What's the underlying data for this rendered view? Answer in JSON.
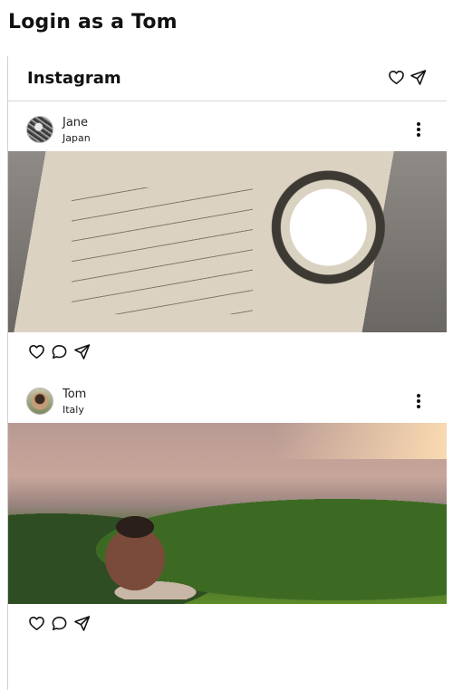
{
  "page": {
    "title": "Login as a Tom"
  },
  "app": {
    "brand": "Instagram",
    "header_icons": [
      "heart-icon",
      "send-icon"
    ]
  },
  "posts": [
    {
      "user": "Jane",
      "location": "Japan",
      "photo": "letters-and-pocket-watch",
      "actions": [
        "heart-icon",
        "comment-icon",
        "send-icon"
      ]
    },
    {
      "user": "Tom",
      "location": "Italy",
      "photo": "couple-by-river",
      "actions": [
        "heart-icon",
        "comment-icon",
        "send-icon"
      ]
    }
  ]
}
